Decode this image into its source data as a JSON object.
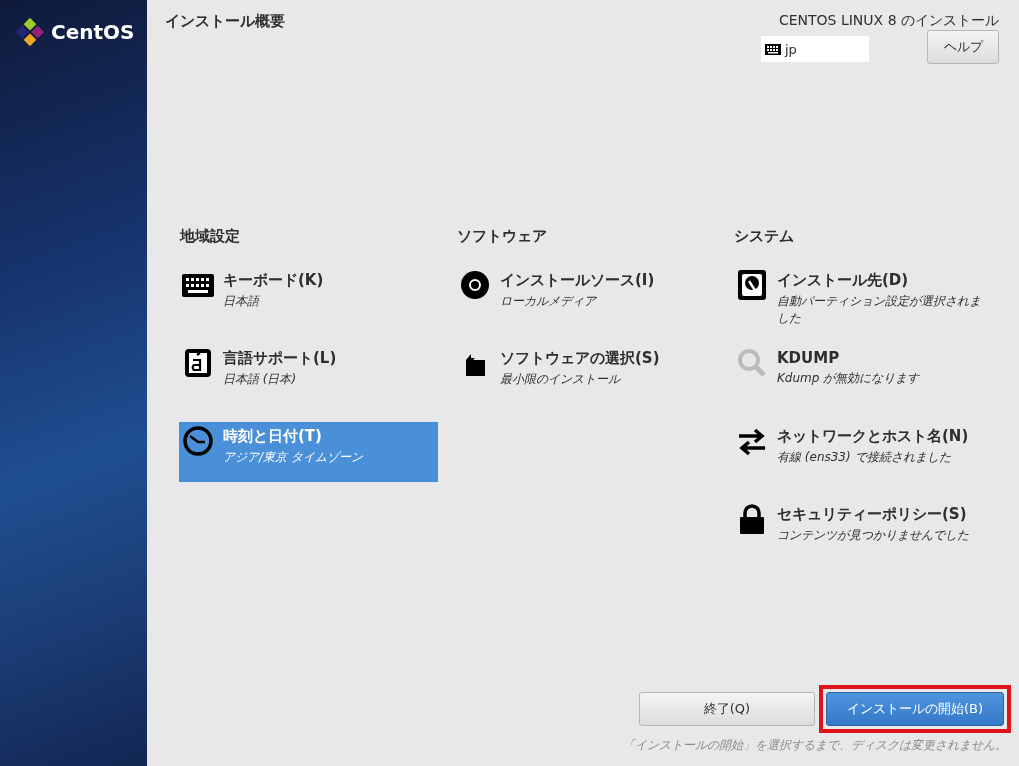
{
  "sidebar": {
    "logo_text": "CentOS"
  },
  "header": {
    "title": "インストール概要",
    "product": "CENTOS LINUX 8 のインストール",
    "keyboard_layout": "jp",
    "help_button": "ヘルプ"
  },
  "sections": [
    {
      "heading": "地域設定",
      "items": [
        {
          "kind": "keyboard",
          "title": "キーボード(K)",
          "status": "日本語",
          "selected": false,
          "dimmed_icon": false
        },
        {
          "kind": "language",
          "title": "言語サポート(L)",
          "status": "日本語 (日本)",
          "selected": false,
          "dimmed_icon": false
        },
        {
          "kind": "clock",
          "title": "時刻と日付(T)",
          "status": "アジア/東京 タイムゾーン",
          "selected": true,
          "dimmed_icon": false
        }
      ]
    },
    {
      "heading": "ソフトウェア",
      "items": [
        {
          "kind": "disc",
          "title": "インストールソース(I)",
          "status": "ローカルメディア",
          "selected": false,
          "dimmed_icon": false
        },
        {
          "kind": "package",
          "title": "ソフトウェアの選択(S)",
          "status": "最小限のインストール",
          "selected": false,
          "dimmed_icon": false
        }
      ]
    },
    {
      "heading": "システム",
      "items": [
        {
          "kind": "disk",
          "title": "インストール先(D)",
          "status": "自動パーティション設定が選択されました",
          "selected": false,
          "dimmed_icon": false
        },
        {
          "kind": "search",
          "title": "KDUMP",
          "status": "Kdump が無効になります",
          "selected": false,
          "dimmed_icon": true
        },
        {
          "kind": "network",
          "title": "ネットワークとホスト名(N)",
          "status": "有線 (ens33) で接続されました",
          "selected": false,
          "dimmed_icon": false
        },
        {
          "kind": "lock",
          "title": "セキュリティーポリシー(S)",
          "status": "コンテンツが見つかりませんでした",
          "selected": false,
          "dimmed_icon": false
        }
      ]
    }
  ],
  "footer": {
    "quit_button": "終了(Q)",
    "begin_button": "インストールの開始(B)",
    "begin_highlighted": true,
    "note": "「インストールの開始」を選択するまで、ディスクは変更されません。"
  }
}
